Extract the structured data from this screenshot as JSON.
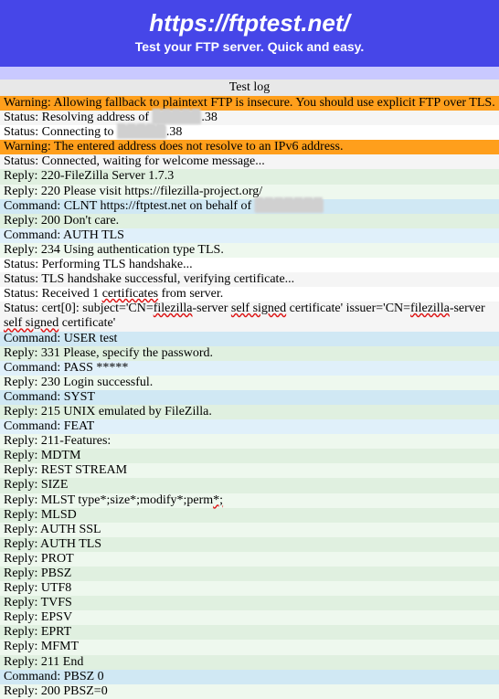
{
  "header": {
    "title": "https://ftptest.net/",
    "subtitle": "Test your FTP server. Quick and easy."
  },
  "log_header": "Test log",
  "rows": [
    {
      "kind": "warning",
      "text": "Warning: Allowing fallback to plaintext FTP is insecure. You should use explicit FTP over TLS."
    },
    {
      "kind": "status",
      "parts": [
        {
          "t": "Status: Resolving address of "
        },
        {
          "t": "▉▉▉▉▉",
          "blur": true
        },
        {
          "t": ".38"
        }
      ]
    },
    {
      "kind": "status",
      "parts": [
        {
          "t": "Status: Connecting to "
        },
        {
          "t": "▉▉▉▉▉",
          "blur": true
        },
        {
          "t": ".38"
        }
      ]
    },
    {
      "kind": "warning",
      "text": "Warning: The entered address does not resolve to an IPv6 address."
    },
    {
      "kind": "status",
      "text": "Status: Connected, waiting for welcome message..."
    },
    {
      "kind": "reply",
      "text": "Reply: 220-FileZilla Server 1.7.3"
    },
    {
      "kind": "reply",
      "text": "Reply: 220 Please visit https://filezilla-project.org/"
    },
    {
      "kind": "command",
      "parts": [
        {
          "t": "Command: CLNT https://ftptest.net on behalf of "
        },
        {
          "t": "▉▉▉▉▉▉▉",
          "blur": true
        }
      ]
    },
    {
      "kind": "reply",
      "text": "Reply: 200 Don't care."
    },
    {
      "kind": "command",
      "text": "Command: AUTH TLS"
    },
    {
      "kind": "reply",
      "text": "Reply: 234 Using authentication type TLS."
    },
    {
      "kind": "status",
      "text": "Status: Performing TLS handshake..."
    },
    {
      "kind": "status",
      "text": "Status: TLS handshake successful, verifying certificate..."
    },
    {
      "kind": "status",
      "parts": [
        {
          "t": "Status: Received 1 "
        },
        {
          "t": "certificates",
          "squiggle": true
        },
        {
          "t": " from server."
        }
      ]
    },
    {
      "kind": "status",
      "parts": [
        {
          "t": "Status: cert[0]: subject='CN="
        },
        {
          "t": "filezilla",
          "squiggle": true
        },
        {
          "t": "-server "
        },
        {
          "t": "self signed",
          "squiggle": true
        },
        {
          "t": " certificate' issuer='CN="
        },
        {
          "t": "filezilla",
          "squiggle": true
        },
        {
          "t": "-server "
        },
        {
          "t": "self signed",
          "squiggle": true
        },
        {
          "t": " certificate'"
        }
      ]
    },
    {
      "kind": "command",
      "text": "Command: USER test"
    },
    {
      "kind": "reply",
      "text": "Reply: 331 Please, specify the password."
    },
    {
      "kind": "command",
      "text": "Command: PASS *****"
    },
    {
      "kind": "reply",
      "text": "Reply: 230 Login successful."
    },
    {
      "kind": "command",
      "text": "Command: SYST"
    },
    {
      "kind": "reply",
      "text": "Reply: 215 UNIX emulated by FileZilla."
    },
    {
      "kind": "command",
      "text": "Command: FEAT"
    },
    {
      "kind": "reply",
      "text": "Reply: 211-Features:"
    },
    {
      "kind": "reply",
      "text": "Reply: MDTM"
    },
    {
      "kind": "reply",
      "text": "Reply: REST STREAM"
    },
    {
      "kind": "reply",
      "text": "Reply: SIZE"
    },
    {
      "kind": "reply",
      "parts": [
        {
          "t": "Reply: MLST type*;size*;modify*;perm"
        },
        {
          "t": "*;",
          "squiggle": true
        }
      ]
    },
    {
      "kind": "reply",
      "text": "Reply: MLSD"
    },
    {
      "kind": "reply",
      "text": "Reply: AUTH SSL"
    },
    {
      "kind": "reply",
      "text": "Reply: AUTH TLS"
    },
    {
      "kind": "reply",
      "text": "Reply: PROT"
    },
    {
      "kind": "reply",
      "text": "Reply: PBSZ"
    },
    {
      "kind": "reply",
      "text": "Reply: UTF8"
    },
    {
      "kind": "reply",
      "text": "Reply: TVFS"
    },
    {
      "kind": "reply",
      "text": "Reply: EPSV"
    },
    {
      "kind": "reply",
      "text": "Reply: EPRT"
    },
    {
      "kind": "reply",
      "text": "Reply: MFMT"
    },
    {
      "kind": "reply",
      "text": "Reply: 211 End"
    },
    {
      "kind": "command",
      "text": "Command: PBSZ 0"
    },
    {
      "kind": "reply",
      "text": "Reply: 200 PBSZ=0"
    }
  ]
}
